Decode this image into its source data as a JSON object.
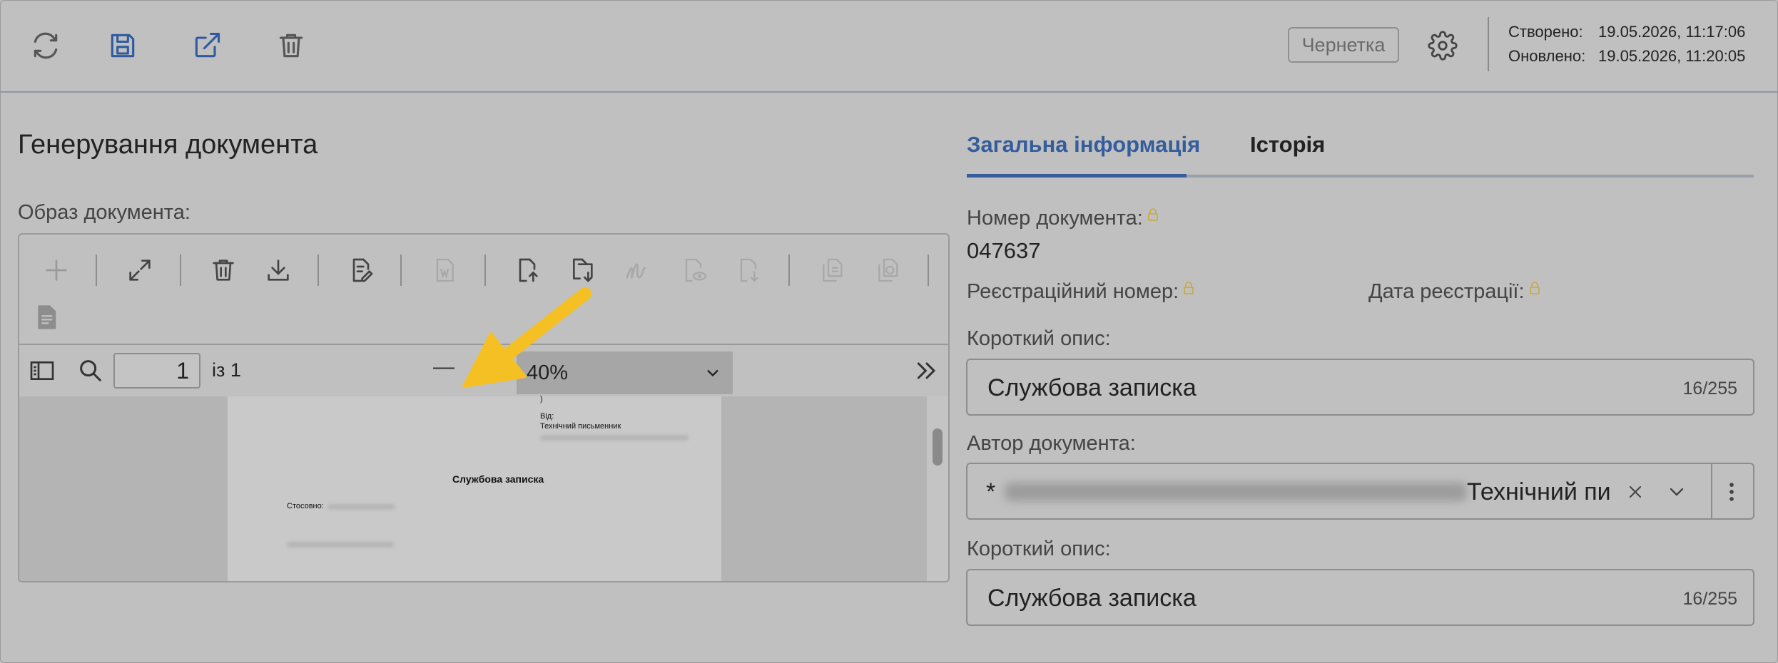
{
  "toolbar": {
    "icons": [
      "refresh-icon",
      "save-icon",
      "external-link-icon",
      "trash-icon"
    ],
    "status_label": "Чернетка",
    "settings_icon": "gear-icon",
    "created_label": "Створено:",
    "created_value": "19.05.2026, 11:17:06",
    "updated_label": "Оновлено:",
    "updated_value": "19.05.2026, 11:20:05"
  },
  "left": {
    "title": "Генерування документа",
    "image_label": "Образ документа:",
    "viewer": {
      "page_current": "1",
      "page_of": "із 1",
      "zoom_minus": "—",
      "zoom_value": "40%",
      "preview": {
        "paren": ")",
        "from_label": "Від:",
        "from_value": "Технічний письменник",
        "heading": "Службова записка",
        "regarding": "Стосовно:"
      }
    }
  },
  "right": {
    "tabs": [
      {
        "label": "Загальна інформація",
        "active": true
      },
      {
        "label": "Історія",
        "active": false
      }
    ],
    "doc_number_label": "Номер документа:",
    "doc_number_value": "047637",
    "reg_number_label": "Реєстраційний номер:",
    "reg_date_label": "Дата реєстрації:",
    "short_desc_label": "Короткий опис:",
    "short_desc_value": "Службова записка",
    "short_desc_count": "16/255",
    "author_label": "Автор документа:",
    "author_prefix": "*",
    "author_value": "Технічний пи",
    "short_desc2_label": "Короткий опис:",
    "short_desc2_value": "Службова записка",
    "short_desc2_count": "16/255"
  },
  "colors": {
    "background": "#c0c0c0",
    "accent": "#355d9c",
    "primary_icon": "#2f5aa0",
    "annotation_arrow": "#f5c023",
    "lock": "#c7a93a"
  }
}
